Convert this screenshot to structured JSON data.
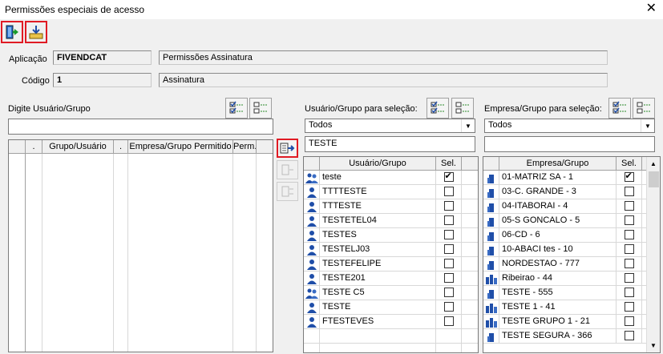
{
  "window": {
    "title": "Permissões especiais de acesso",
    "close": "✕"
  },
  "toolbar": {
    "exit_icon": "door-exit-icon",
    "save_icon": "import-tray-icon"
  },
  "form": {
    "aplicacao_label": "Aplicação",
    "aplicacao_code": "FIVENDCAT",
    "aplicacao_desc": "Permissões Assinatura",
    "codigo_label": "Código",
    "codigo_value": "1",
    "codigo_desc": "Assinatura"
  },
  "left_panel": {
    "label": "Digite Usuário/Grupo",
    "input_value": "",
    "columns": [
      ".",
      "Grupo/Usuário",
      ".",
      "Empresa/Grupo Permitido",
      "Perm."
    ]
  },
  "middle_panel": {
    "label": "Usuário/Grupo para seleção:",
    "filter_value": "Todos",
    "search_value": "TESTE",
    "columns": [
      "Usuário/Grupo",
      "Sel."
    ],
    "rows": [
      {
        "icon": "group",
        "name": "teste",
        "sel": true
      },
      {
        "icon": "user",
        "name": "TTTTESTE",
        "sel": false
      },
      {
        "icon": "user",
        "name": "TTTESTE",
        "sel": false
      },
      {
        "icon": "user",
        "name": "TESTETEL04",
        "sel": false
      },
      {
        "icon": "user",
        "name": "TESTES",
        "sel": false
      },
      {
        "icon": "user",
        "name": "TESTELJ03",
        "sel": false
      },
      {
        "icon": "user",
        "name": "TESTEFELIPE",
        "sel": false
      },
      {
        "icon": "user",
        "name": "TESTE201",
        "sel": false
      },
      {
        "icon": "group",
        "name": "TESTE C5",
        "sel": false
      },
      {
        "icon": "user",
        "name": "TESTE",
        "sel": false
      },
      {
        "icon": "user",
        "name": "FTESTEVES",
        "sel": false
      }
    ]
  },
  "right_panel": {
    "label": "Empresa/Grupo para seleção:",
    "filter_value": "Todos",
    "search_value": "",
    "columns": [
      "Empresa/Grupo",
      "Sel."
    ],
    "rows": [
      {
        "icon": "company",
        "name": "01-MATRIZ SA - 1",
        "sel": true
      },
      {
        "icon": "company",
        "name": "03-C. GRANDE - 3",
        "sel": false
      },
      {
        "icon": "company",
        "name": "04-ITABORAI - 4",
        "sel": false
      },
      {
        "icon": "company",
        "name": "05-S GONCALO - 5",
        "sel": false
      },
      {
        "icon": "company",
        "name": "06-CD - 6",
        "sel": false
      },
      {
        "icon": "company",
        "name": "10-ABACI tes - 10",
        "sel": false
      },
      {
        "icon": "company",
        "name": "NORDESTAO - 777",
        "sel": false
      },
      {
        "icon": "company-group",
        "name": "Ribeirao - 44",
        "sel": false
      },
      {
        "icon": "company",
        "name": "TESTE - 555",
        "sel": false
      },
      {
        "icon": "company-group",
        "name": "TESTE  1 - 41",
        "sel": false
      },
      {
        "icon": "company-group",
        "name": "TESTE GRUPO 1 - 21",
        "sel": false
      },
      {
        "icon": "company",
        "name": "TESTE SEGURA - 366",
        "sel": false
      }
    ]
  },
  "colors": {
    "highlight": "#e01b24",
    "user_icon": "#1f4ea8"
  }
}
